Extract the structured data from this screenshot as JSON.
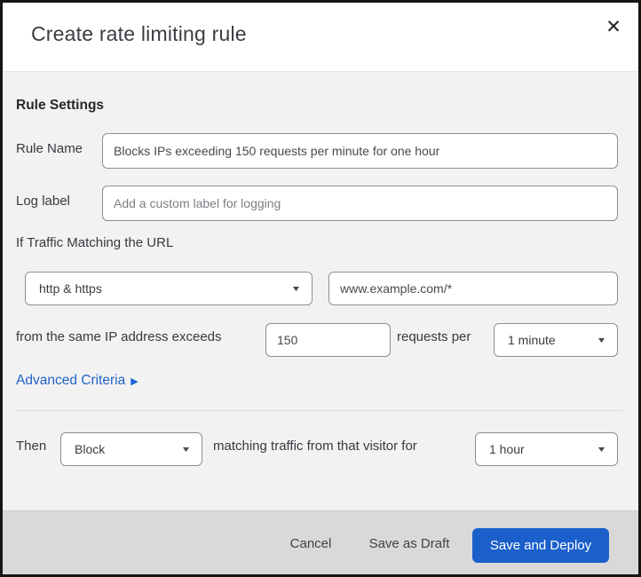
{
  "dialog": {
    "title": "Create rate limiting rule"
  },
  "icons": {
    "close": "✕",
    "caret": "▼",
    "advanced_arrow": "▶"
  },
  "rule_settings": {
    "heading": "Rule Settings",
    "rule_name_label": "Rule Name",
    "rule_name_value": "Blocks IPs exceeding 150 requests per minute for one hour",
    "log_label_label": "Log label",
    "log_label_placeholder": "Add a custom label for logging"
  },
  "criteria": {
    "if_text": "If Traffic Matching the URL",
    "protocol_value": "http & https",
    "url_value": "www.example.com/*",
    "exceeds_text": "from the same IP address exceeds",
    "count_value": "150",
    "requests_per_text": "requests per",
    "period_value": "1 minute",
    "advanced_link": "Advanced Criteria"
  },
  "action": {
    "then_text": "Then",
    "action_value": "Block",
    "matching_text": "matching traffic from that visitor for",
    "duration_value": "1 hour"
  },
  "footer": {
    "cancel": "Cancel",
    "save_draft": "Save as Draft",
    "save_deploy": "Save and Deploy"
  },
  "colors": {
    "primary_blue": "#1b5fca",
    "link_blue": "#2163c6",
    "body_bg": "#f2f2f2",
    "footer_bg": "#d9d9d9",
    "header_bg": "#ffffff"
  }
}
